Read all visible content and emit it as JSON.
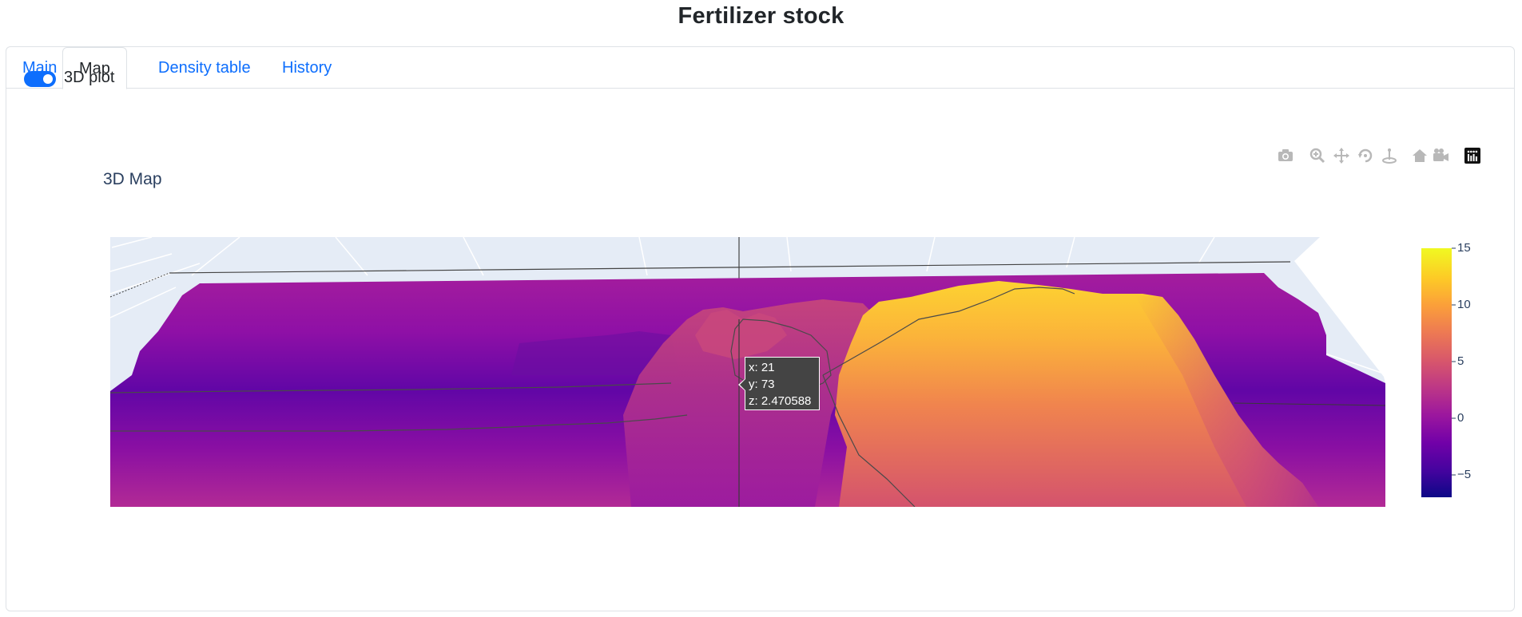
{
  "page": {
    "title": "Fertilizer stock"
  },
  "tabs": [
    {
      "label": "Main",
      "active": false
    },
    {
      "label": "Map",
      "active": true
    },
    {
      "label": "Density table",
      "active": false
    },
    {
      "label": "History",
      "active": false
    }
  ],
  "toggle": {
    "label": "3D plot",
    "checked": true,
    "color": "#0d6efd"
  },
  "plot": {
    "title": "3D Map",
    "modebar": [
      "camera-icon",
      "zoom-icon",
      "pan-icon",
      "orbit-rotation-icon",
      "turntable-rotation-icon",
      "reset-camera-home-icon",
      "camera-last-save-icon",
      "plotly-logo-icon"
    ],
    "colorscale": [
      "#0d0887",
      "#46039f",
      "#7201a8",
      "#9c179e",
      "#bd3786",
      "#d8576b",
      "#ed7953",
      "#fb9f3a",
      "#fdca26",
      "#f0f921"
    ],
    "colorbar_ticks": [
      "15",
      "10",
      "5",
      "0",
      "−5"
    ],
    "hover": {
      "x": "x: 21",
      "y": "y: 73",
      "z": "z: 2.470588"
    }
  },
  "chart_data": {
    "type": "surface",
    "title": "3D Map",
    "colorbar": {
      "ticks": [
        15,
        10,
        5,
        0,
        -5
      ],
      "range": [
        -7,
        15
      ]
    },
    "hover_point": {
      "x": 21,
      "y": 73,
      "z": 2.470588
    }
  }
}
